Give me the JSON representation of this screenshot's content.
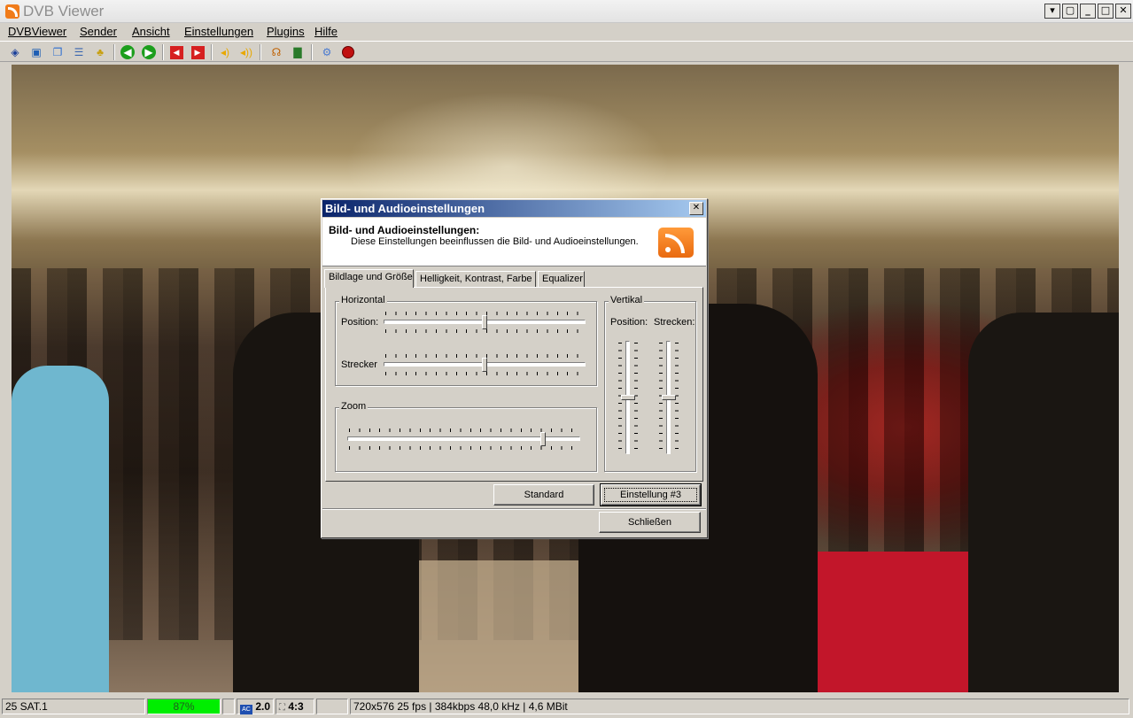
{
  "window": {
    "title": "DVB Viewer",
    "buttons": [
      "▾",
      "▢",
      "_",
      "□",
      "✕"
    ]
  },
  "menu": [
    "DVBViewer",
    "Sender",
    "Ansicht",
    "Einstellungen",
    "Plugins",
    "Hilfe"
  ],
  "status": {
    "channel": "25 SAT.1",
    "signal": "87%",
    "signal_percent": 87,
    "audio": "2.0",
    "aspect": "4:3",
    "info": "720x576 25 fps | 384kbps 48,0 kHz | 4,6 MBit"
  },
  "dialog": {
    "title": "Bild- und Audioeinstellungen",
    "header_title": "Bild- und Audioeinstellungen:",
    "header_desc": "Diese Einstellungen beeinflussen die Bild- und Audioeinstellungen.",
    "tabs": [
      "Bildlage und Größe",
      "Helligkeit, Kontrast, Farbe",
      "Equalizer"
    ],
    "horizontal": {
      "label": "Horizontal",
      "position_label": "Position:",
      "stretch_label": "Strecker",
      "position_value": 0.5,
      "stretch_value": 0.5
    },
    "zoom": {
      "label": "Zoom",
      "value": 0.84
    },
    "vertical": {
      "label": "Vertikal",
      "position_label": "Position:",
      "stretch_label": "Strecken:",
      "position_value": 0.5,
      "stretch_value": 0.5
    },
    "buttons": {
      "standard": "Standard",
      "preset": "Einstellung #3",
      "close": "Schließen"
    }
  }
}
